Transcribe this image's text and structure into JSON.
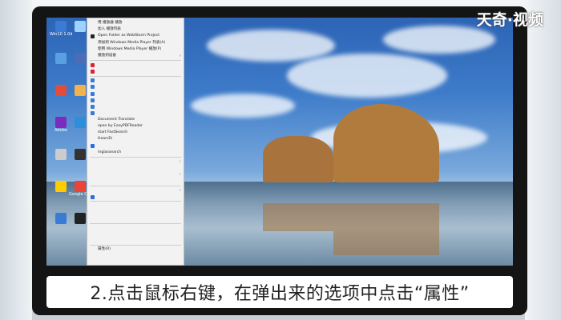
{
  "logo": "天奇·视频",
  "caption": "2.点击鼠标右键，在弹出来的选项中点击“属性”",
  "desktop_icons": [
    {
      "label": "Win10\n1.0d",
      "icon": "app-icon",
      "color": "#3a7bd5"
    },
    {
      "label": "",
      "icon": "file-icon",
      "color": "#9fd3ff"
    },
    {
      "label": "",
      "icon": "network-icon",
      "color": "#5aa0e0"
    },
    {
      "label": "",
      "icon": "folder-icon",
      "color": "#4b6cb7"
    },
    {
      "label": "",
      "icon": "qq-icon",
      "color": "#e34b3b"
    },
    {
      "label": "",
      "icon": "shortcut-icon",
      "color": "#f0b24a"
    },
    {
      "label": "Adobe",
      "icon": "adobe-icon",
      "color": "#7b2cbf"
    },
    {
      "label": "",
      "icon": "disk-icon",
      "color": "#2d8fd8"
    },
    {
      "label": "",
      "icon": "mail-icon",
      "color": "#cccccc"
    },
    {
      "label": "",
      "icon": "gear-icon",
      "color": "#333333"
    },
    {
      "label": "",
      "icon": "chrome-icon",
      "color": "#ffcc00"
    },
    {
      "label": "Google\nChrome",
      "icon": "browser-icon",
      "color": "#eb4335"
    },
    {
      "label": "",
      "icon": "file-icon",
      "color": "#3a7bd5"
    },
    {
      "label": "",
      "icon": "app-icon",
      "color": "#222222"
    }
  ],
  "context_menu": {
    "items": [
      {
        "label": "用 播放器 播放",
        "icon": "",
        "arrow": false
      },
      {
        "label": "加入 播放列表",
        "icon": "",
        "arrow": false
      },
      {
        "label": "Open Folder as WebStorm Project",
        "icon": "webstorm-icon",
        "arrow": false
      },
      {
        "label": "添加到 Windows Media Player 列表(A)",
        "icon": "",
        "arrow": false
      },
      {
        "label": "使用 Windows Media Player 播放(P)",
        "icon": "",
        "arrow": false
      },
      {
        "label": "播放到设备",
        "icon": "",
        "arrow": true
      },
      {
        "sep": true
      },
      {
        "label": "",
        "icon": "pdf-icon",
        "arrow": false
      },
      {
        "label": "",
        "icon": "pdf-icon",
        "arrow": false
      },
      {
        "sep": true
      },
      {
        "label": "",
        "icon": "archive-icon",
        "arrow": false
      },
      {
        "label": "",
        "icon": "archive-icon",
        "arrow": false
      },
      {
        "label": "",
        "icon": "archive-icon",
        "arrow": false
      },
      {
        "label": "",
        "icon": "archive-icon",
        "arrow": false
      },
      {
        "label": "",
        "icon": "archive-icon",
        "arrow": false
      },
      {
        "label": "",
        "icon": "archive-icon",
        "arrow": false
      },
      {
        "label": "Document Translate",
        "icon": "",
        "arrow": false
      },
      {
        "label": "open by EasyPDFReader",
        "icon": "",
        "arrow": false
      },
      {
        "label": "start FastSearch",
        "icon": "",
        "arrow": false
      },
      {
        "label": "HearcEt",
        "icon": "",
        "arrow": false
      },
      {
        "label": "",
        "icon": "wps-icon",
        "arrow": false
      },
      {
        "label": "mglassearch",
        "icon": "",
        "arrow": false
      },
      {
        "sep": true
      },
      {
        "label": "",
        "icon": "",
        "arrow": true
      },
      {
        "label": "",
        "icon": "",
        "arrow": false
      },
      {
        "label": "",
        "icon": "",
        "arrow": true
      },
      {
        "label": "",
        "icon": "",
        "arrow": false
      },
      {
        "sep": true
      },
      {
        "label": "",
        "icon": "",
        "arrow": true
      },
      {
        "label": "",
        "icon": "scan-icon",
        "arrow": false
      },
      {
        "sep": true
      },
      {
        "label": "",
        "icon": "",
        "arrow": false
      },
      {
        "label": "",
        "icon": "",
        "arrow": false
      },
      {
        "label": "",
        "icon": "",
        "arrow": false
      },
      {
        "sep": true
      },
      {
        "label": "",
        "icon": "",
        "arrow": false
      },
      {
        "label": "",
        "icon": "",
        "arrow": false
      },
      {
        "label": "",
        "icon": "",
        "arrow": false
      },
      {
        "sep": true
      },
      {
        "label": "属性(R)",
        "icon": "",
        "arrow": false
      }
    ]
  }
}
